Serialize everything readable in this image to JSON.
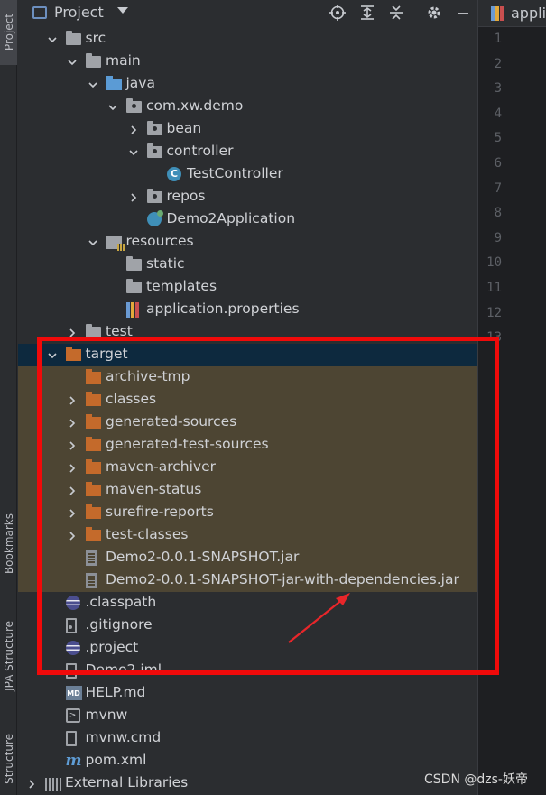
{
  "tool_strip": {
    "project_tab": "Project",
    "bookmarks_tab": "Bookmarks",
    "jpa_structure_tab": "JPA Structure",
    "structure_tab": "Structure"
  },
  "panel_header": {
    "title": "Project",
    "buttons": [
      "locate-icon",
      "expand-all-icon",
      "collapse-all-icon",
      "gear-icon",
      "minimize-icon"
    ]
  },
  "tree": [
    {
      "label": "src",
      "indent": 1,
      "chevron": "down",
      "icon": "folder-grey"
    },
    {
      "label": "main",
      "indent": 2,
      "chevron": "down",
      "icon": "folder-grey"
    },
    {
      "label": "java",
      "indent": 3,
      "chevron": "down",
      "icon": "folder-blue"
    },
    {
      "label": "com.xw.demo",
      "indent": 4,
      "chevron": "down",
      "icon": "package"
    },
    {
      "label": "bean",
      "indent": 5,
      "chevron": "right",
      "icon": "package"
    },
    {
      "label": "controller",
      "indent": 5,
      "chevron": "down",
      "icon": "package"
    },
    {
      "label": "TestController",
      "indent": 6,
      "chevron": "",
      "icon": "class"
    },
    {
      "label": "repos",
      "indent": 5,
      "chevron": "right",
      "icon": "package"
    },
    {
      "label": "Demo2Application",
      "indent": 5,
      "chevron": "",
      "icon": "spring-class"
    },
    {
      "label": "resources",
      "indent": 3,
      "chevron": "down",
      "icon": "resources-folder"
    },
    {
      "label": "static",
      "indent": 4,
      "chevron": "",
      "icon": "folder-grey"
    },
    {
      "label": "templates",
      "indent": 4,
      "chevron": "",
      "icon": "folder-grey"
    },
    {
      "label": "application.properties",
      "indent": 4,
      "chevron": "",
      "icon": "properties"
    },
    {
      "label": "test",
      "indent": 2,
      "chevron": "right",
      "icon": "folder-grey"
    },
    {
      "label": "target",
      "indent": 1,
      "chevron": "down",
      "icon": "folder-orange",
      "state": "selected"
    },
    {
      "label": "archive-tmp",
      "indent": 2,
      "chevron": "",
      "icon": "folder-orange",
      "state": "excluded"
    },
    {
      "label": "classes",
      "indent": 2,
      "chevron": "right",
      "icon": "folder-orange",
      "state": "excluded"
    },
    {
      "label": "generated-sources",
      "indent": 2,
      "chevron": "right",
      "icon": "folder-orange",
      "state": "excluded"
    },
    {
      "label": "generated-test-sources",
      "indent": 2,
      "chevron": "right",
      "icon": "folder-orange",
      "state": "excluded"
    },
    {
      "label": "maven-archiver",
      "indent": 2,
      "chevron": "right",
      "icon": "folder-orange",
      "state": "excluded"
    },
    {
      "label": "maven-status",
      "indent": 2,
      "chevron": "right",
      "icon": "folder-orange",
      "state": "excluded"
    },
    {
      "label": "surefire-reports",
      "indent": 2,
      "chevron": "right",
      "icon": "folder-orange",
      "state": "excluded"
    },
    {
      "label": "test-classes",
      "indent": 2,
      "chevron": "right",
      "icon": "folder-orange",
      "state": "excluded"
    },
    {
      "label": "Demo2-0.0.1-SNAPSHOT.jar",
      "indent": 2,
      "chevron": "",
      "icon": "jar",
      "state": "excluded"
    },
    {
      "label": "Demo2-0.0.1-SNAPSHOT-jar-with-dependencies.jar",
      "indent": 2,
      "chevron": "",
      "icon": "jar",
      "state": "excluded"
    },
    {
      "label": ".classpath",
      "indent": 1,
      "chevron": "",
      "icon": "eclipse"
    },
    {
      "label": ".gitignore",
      "indent": 1,
      "chevron": "",
      "icon": "gitignore"
    },
    {
      "label": ".project",
      "indent": 1,
      "chevron": "",
      "icon": "eclipse"
    },
    {
      "label": "Demo2.iml",
      "indent": 1,
      "chevron": "",
      "icon": "file"
    },
    {
      "label": "HELP.md",
      "indent": 1,
      "chevron": "",
      "icon": "markdown"
    },
    {
      "label": "mvnw",
      "indent": 1,
      "chevron": "",
      "icon": "terminal"
    },
    {
      "label": "mvnw.cmd",
      "indent": 1,
      "chevron": "",
      "icon": "file"
    },
    {
      "label": "pom.xml",
      "indent": 1,
      "chevron": "",
      "icon": "maven"
    },
    {
      "label": "External Libraries",
      "indent": 0,
      "chevron": "right",
      "icon": "libraries"
    }
  ],
  "editor": {
    "tab_label": "applic",
    "line_numbers": [
      "1",
      "2",
      "3",
      "4",
      "5",
      "6",
      "7",
      "8",
      "9",
      "10",
      "11",
      "12",
      "13"
    ]
  },
  "annotation": {
    "box_color": "#f00a0a",
    "arrow_color": "#e8262a"
  },
  "watermark": "CSDN @dzs-妖帝"
}
